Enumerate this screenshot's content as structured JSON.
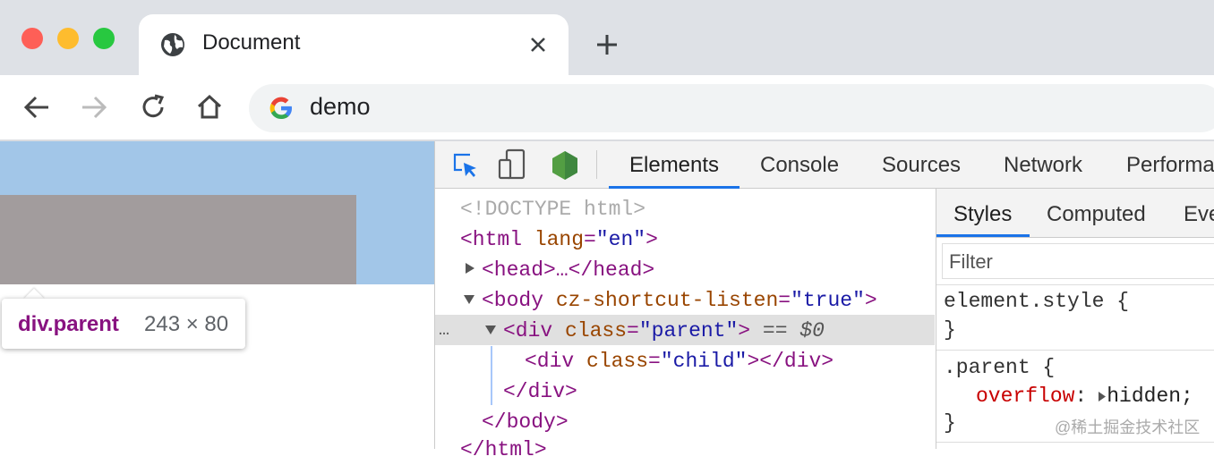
{
  "browser": {
    "tab_title": "Document",
    "address": "demo",
    "window_dots": [
      "#fe5f57",
      "#febc2e",
      "#28c840"
    ]
  },
  "page": {
    "tooltip_selector": "div.parent",
    "tooltip_size": "243 × 80",
    "outer_color": "#a2c6e8",
    "inner_color": "#a29c9d"
  },
  "devtools": {
    "tabs": [
      "Elements",
      "Console",
      "Sources",
      "Network",
      "Performa"
    ],
    "dom": {
      "doctype": "<!DOCTYPE html>",
      "html_open": "<html",
      "html_lang_attr": " lang",
      "html_lang_val": "\"en\"",
      "html_close_bracket": ">",
      "head": "<head>…</head>",
      "body_open": "<body",
      "body_attr": " cz-shortcut-listen",
      "body_val": "\"true\"",
      "body_close_bracket": ">",
      "div_parent_open": "<div",
      "div_parent_attr": " class",
      "div_parent_val": "\"parent\"",
      "div_parent_close": ">",
      "selected_marker": " == $0",
      "div_child_open": "<div",
      "div_child_attr": " class",
      "div_child_val": "\"child\"",
      "div_child_close": "></div>",
      "div_end": "</div>",
      "body_end": "</body>",
      "html_end": "</html>",
      "ellipsis": "…"
    },
    "styles_tabs": [
      "Styles",
      "Computed",
      "Eve"
    ],
    "filter_placeholder": "Filter",
    "rules": {
      "element_style_open": "element.style {",
      "element_style_close": "}",
      "parent_selector": ".parent {",
      "parent_prop": "overflow",
      "parent_colon": ":",
      "parent_value": "hidden;",
      "parent_close": "}"
    }
  },
  "watermark": "@稀土掘金技术社区"
}
